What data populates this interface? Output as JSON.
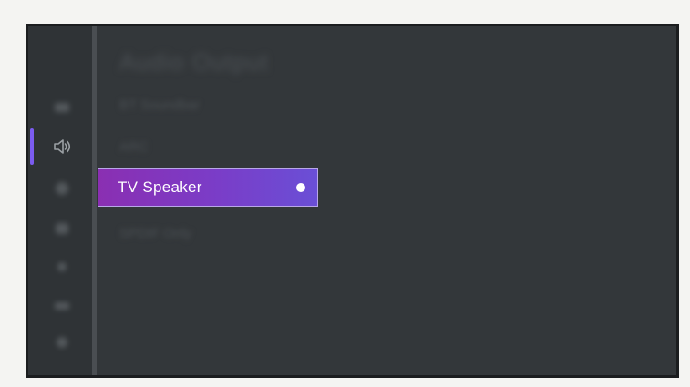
{
  "header": {
    "title": "Audio Output"
  },
  "menu": {
    "items": [
      {
        "label": "BT Soundbar"
      },
      {
        "label": "ARC"
      },
      {
        "label": "TV Speaker",
        "selected": true
      },
      {
        "label": "SPDIF Only"
      }
    ]
  },
  "sidebar": {
    "items": [
      {
        "icon": "picture-icon"
      },
      {
        "icon": "speaker-icon",
        "active": true
      },
      {
        "icon": "network-icon"
      },
      {
        "icon": "display-icon"
      },
      {
        "icon": "brightness-icon"
      },
      {
        "icon": "input-icon"
      },
      {
        "icon": "settings-icon"
      }
    ]
  },
  "colors": {
    "accent": "#7b5cf0",
    "selected_gradient_start": "#8a2fb2",
    "selected_gradient_end": "#6a4fd6",
    "background": "#33373a"
  }
}
